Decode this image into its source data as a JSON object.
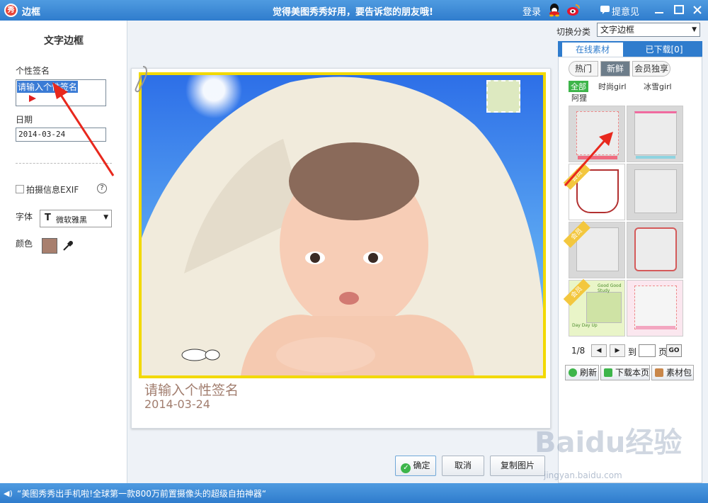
{
  "titlebar": {
    "title": "边框",
    "slogan": "觉得美图秀秀好用，要告诉您的朋友哦!",
    "login": "登录",
    "feedback": "提意见"
  },
  "left": {
    "heading": "文字边框",
    "signature_label": "个性签名",
    "signature_value": "请输入个性签名",
    "date_label": "日期",
    "date_value": "2014-03-24",
    "exif_label": "拍摄信息EXIF",
    "help": "?",
    "font_label": "字体",
    "font_value": "微软雅黑",
    "color_label": "颜色"
  },
  "preview": {
    "signature_text": "请输入个性签名",
    "date_text": "2014-03-24"
  },
  "buttons": {
    "ok": "确定",
    "cancel": "取消",
    "copy": "复制图片"
  },
  "right": {
    "category_label": "切换分类",
    "category_value": "文字边框",
    "tab_online": "在线素材",
    "tab_downloaded": "已下载[0]",
    "subtab_hot": "热门",
    "subtab_new": "新鲜",
    "subtab_vip": "会员独享",
    "filters": [
      "全部",
      "时尚girl",
      "冰雪girl",
      "阿狸"
    ],
    "vip_badge": "会员",
    "thumb_texts": [
      "Good Good Study",
      "Day Day Up"
    ],
    "pager_current": "1/8",
    "pager_to": "到",
    "pager_unit": "页",
    "go": "GO",
    "refresh": "刷新",
    "download_page": "下载本页",
    "material_pack": "素材包"
  },
  "statusbar": {
    "text": "“美图秀秀出手机啦!全球第一款800万前置摄像头的超级自拍神器“"
  },
  "watermark": {
    "main": "Baidu经验",
    "sub": "jingyan.baidu.com"
  },
  "colors": {
    "titlebar": "#2f7ccd",
    "border_yellow": "#f2d900",
    "text_color_swatch": "#a87f6e",
    "green": "#3db54a"
  }
}
